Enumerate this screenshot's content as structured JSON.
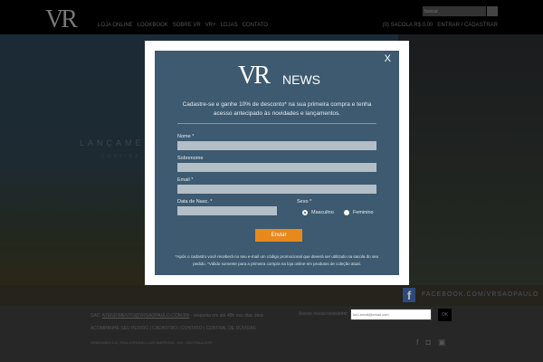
{
  "header": {
    "logo": "VR",
    "nav": [
      "LOJA ONLINE",
      "LOOKBOOK",
      "SOBRE VR",
      "VR+",
      "LOJAS",
      "CONTATO"
    ],
    "search_placeholder": "buscar",
    "bag": "(0) SACOLA R$ 0,00",
    "account": "ENTRAR / CADASTRAR"
  },
  "hero": {
    "title": "LANÇAMENTOS",
    "subtitle": "CONFIRA A COLEÇÃO"
  },
  "facebook": {
    "label": "FACEBOOK.COM/VRSAOPAULO"
  },
  "footer": {
    "sac_prefix": "SAC:",
    "sac_email": "ATENDIMENTO@VRSAOPAULO.COM.BR",
    "sac_suffix": "- resposta em até 48h nos dias úteis",
    "newsletter_label": "Assine nossa newsletter",
    "newsletter_placeholder": "seu-email@email.com",
    "ok": "OK",
    "links": [
      "ACOMPANHE SEU PEDIDO",
      "CADASTRO",
      "CONTATO",
      "CENTRAL DE DÚVIDAS"
    ],
    "address": "VRBRANDS S.A | RUA CORONEL LUIS BARROSO, 194 - SÃO PAULO/SP"
  },
  "modal": {
    "logo": "VR",
    "news": "NEWS",
    "close": "X",
    "intro": "Cadastre-se e ganhe 10% de desconto* na sua primeira compra e tenha acesso antecipado às novidades e lançamentos.",
    "fields": {
      "nome": "Nome *",
      "sobrenome": "Sobrenome",
      "email": "Email *",
      "nasc": "Data de Nasc. *",
      "sexo": "Sexo *"
    },
    "gender": {
      "male": "Masculino",
      "female": "Feminino",
      "selected": "Masculino"
    },
    "submit": "Enviar",
    "note": "*Após o cadastro você receberá no seu e-mail um código promocional que deverá ser utilizado na sacola do seu pedido. *Válido somente para a primeira compra na loja online em produtos de coleção atual."
  }
}
